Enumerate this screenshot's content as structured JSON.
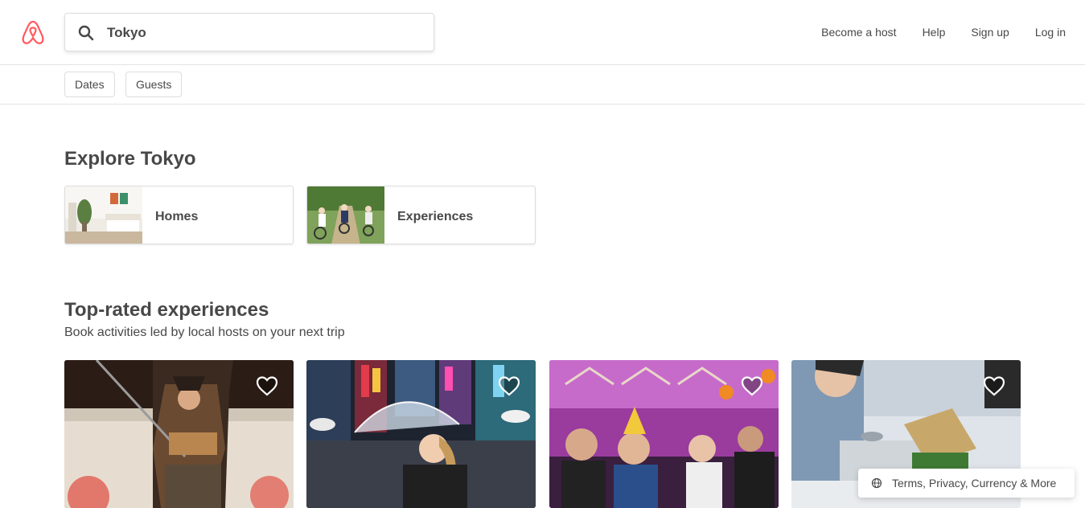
{
  "brand": {
    "color": "#FF5A5F",
    "logo_icon": "airbnb-belo-icon"
  },
  "search": {
    "value": "Tokyo",
    "icon": "search-icon"
  },
  "nav": [
    "Become a host",
    "Help",
    "Sign up",
    "Log in"
  ],
  "filters": [
    "Dates",
    "Guests"
  ],
  "explore": {
    "title": "Explore Tokyo",
    "cards": [
      {
        "label": "Homes"
      },
      {
        "label": "Experiences"
      }
    ]
  },
  "experiences": {
    "title": "Top-rated experiences",
    "subtitle": "Book activities led by local hosts on your next trip",
    "favorite_icon": "heart-icon"
  },
  "footer": {
    "label": "Terms, Privacy, Currency & More",
    "icon": "globe-icon"
  }
}
